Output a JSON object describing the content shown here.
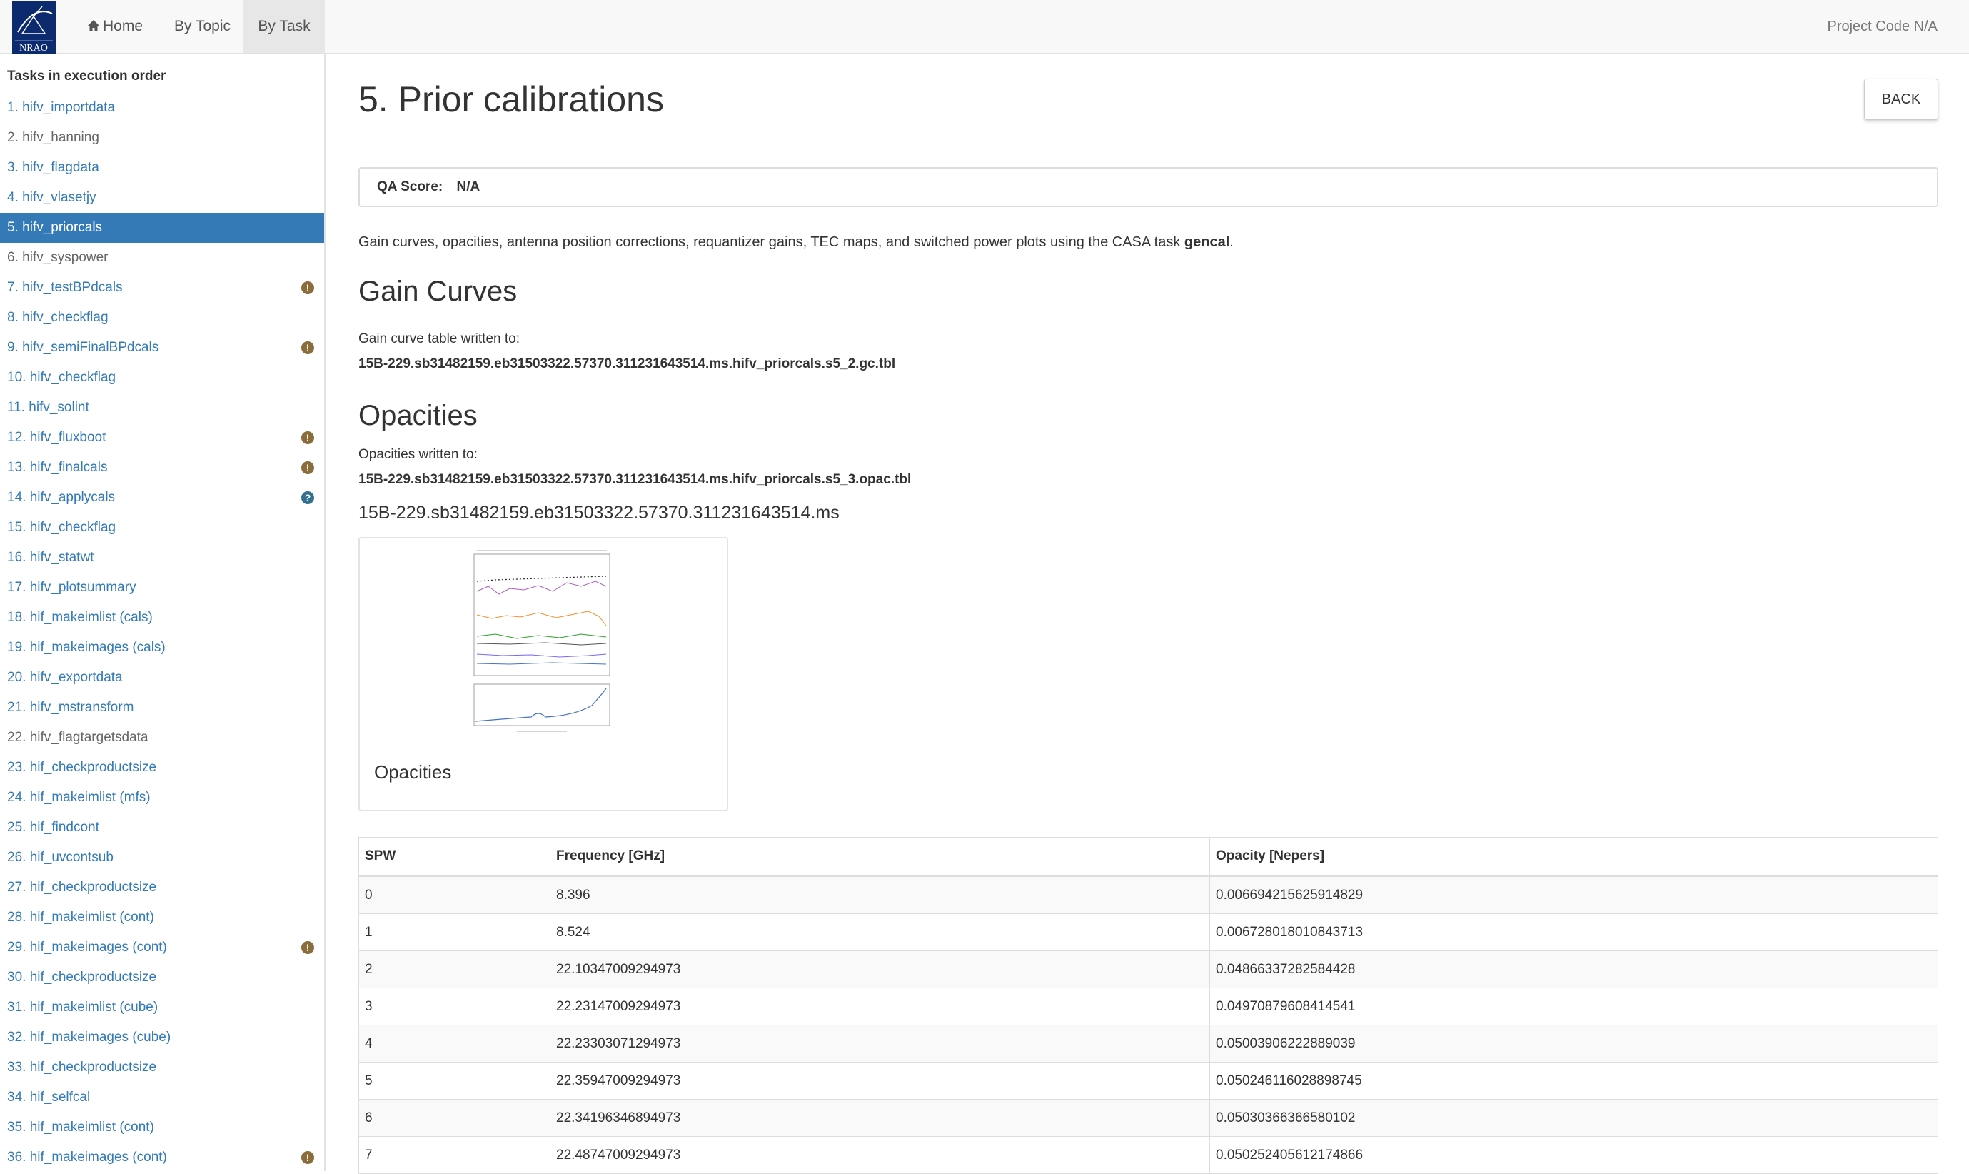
{
  "nav": {
    "logo_text": "NRAO",
    "items": [
      {
        "label": "Home",
        "icon": "home-icon"
      },
      {
        "label": "By Topic"
      },
      {
        "label": "By Task"
      }
    ],
    "project_code": "Project Code N/A"
  },
  "sidebar": {
    "header": "Tasks in execution order",
    "items": [
      {
        "label": "1. hifv_importdata"
      },
      {
        "label": "2. hifv_hanning"
      },
      {
        "label": "3. hifv_flagdata"
      },
      {
        "label": "4. hifv_vlasetjy"
      },
      {
        "label": "5. hifv_priorcals"
      },
      {
        "label": "6. hifv_syspower"
      },
      {
        "label": "7. hifv_testBPdcals",
        "badge": "!"
      },
      {
        "label": "8. hifv_checkflag"
      },
      {
        "label": "9. hifv_semiFinalBPdcals",
        "badge": "!"
      },
      {
        "label": "10. hifv_checkflag"
      },
      {
        "label": "11. hifv_solint"
      },
      {
        "label": "12. hifv_fluxboot",
        "badge": "!"
      },
      {
        "label": "13. hifv_finalcals",
        "badge": "!"
      },
      {
        "label": "14. hifv_applycals",
        "badge": "?"
      },
      {
        "label": "15. hifv_checkflag"
      },
      {
        "label": "16. hifv_statwt"
      },
      {
        "label": "17. hifv_plotsummary"
      },
      {
        "label": "18. hif_makeimlist (cals)"
      },
      {
        "label": "19. hif_makeimages (cals)"
      },
      {
        "label": "20. hifv_exportdata"
      },
      {
        "label": "21. hifv_mstransform"
      },
      {
        "label": "22. hifv_flagtargetsdata"
      },
      {
        "label": "23. hif_checkproductsize"
      },
      {
        "label": "24. hif_makeimlist (mfs)"
      },
      {
        "label": "25. hif_findcont"
      },
      {
        "label": "26. hif_uvcontsub"
      },
      {
        "label": "27. hif_checkproductsize"
      },
      {
        "label": "28. hif_makeimlist (cont)"
      },
      {
        "label": "29. hif_makeimages (cont)",
        "badge": "!"
      },
      {
        "label": "30. hif_checkproductsize"
      },
      {
        "label": "31. hif_makeimlist (cube)"
      },
      {
        "label": "32. hif_makeimages (cube)"
      },
      {
        "label": "33. hif_checkproductsize"
      },
      {
        "label": "34. hif_selfcal"
      },
      {
        "label": "35. hif_makeimlist (cont)"
      },
      {
        "label": "36. hif_makeimages (cont)",
        "badge": "!"
      }
    ]
  },
  "main": {
    "title": "5. Prior calibrations",
    "back_label": "BACK",
    "qa_label": "QA Score:",
    "qa_value": "N/A",
    "intro_text": "Gain curves, opacities, antenna position corrections, requantizer gains, TEC maps, and switched power plots using the CASA task ",
    "intro_task": "gencal",
    "intro_end": ".",
    "gain_heading": "Gain Curves",
    "gain_written": "Gain curve table written to:",
    "gain_table": "15B-229.sb31482159.eb31503322.57370.311231643514.ms.hifv_priorcals.s5_2.gc.tbl",
    "opac_heading": "Opacities",
    "opac_written": "Opacities written to:",
    "opac_table": "15B-229.sb31482159.eb31503322.57370.311231643514.ms.hifv_priorcals.s5_3.opac.tbl",
    "ms_heading": "15B-229.sb31482159.eb31503322.57370.311231643514.ms",
    "thumb_caption": "Opacities",
    "table": {
      "headers": [
        "SPW",
        "Frequency [GHz]",
        "Opacity [Nepers]"
      ],
      "rows": [
        [
          "0",
          "8.396",
          "0.006694215625914829"
        ],
        [
          "1",
          "8.524",
          "0.006728018010843713"
        ],
        [
          "2",
          "22.10347009294973",
          "0.04866337282584428"
        ],
        [
          "3",
          "22.23147009294973",
          "0.04970879608414541"
        ],
        [
          "4",
          "22.23303071294973",
          "0.05003906222889039"
        ],
        [
          "5",
          "22.35947009294973",
          "0.050246116028898745"
        ],
        [
          "6",
          "22.34196346894973",
          "0.05030366366580102"
        ],
        [
          "7",
          "22.48747009294973",
          "0.050252405612174866"
        ]
      ]
    }
  },
  "colors": {
    "link": "#337ab7",
    "active_bg": "#337ab7",
    "warning_badge": "#8a6d3b",
    "info_badge": "#31708f"
  }
}
